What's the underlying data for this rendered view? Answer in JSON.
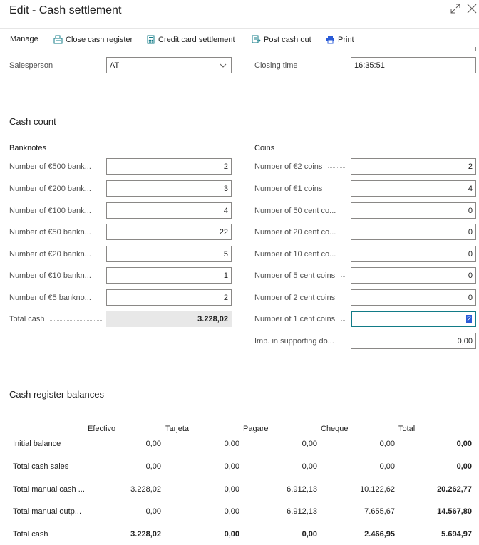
{
  "window": {
    "title": "Edit - Cash settlement"
  },
  "toolbar": {
    "manage": "Manage",
    "close_register": "Close cash register",
    "credit_card": "Credit card settlement",
    "post_cash_out": "Post cash out",
    "print": "Print"
  },
  "header": {
    "salesperson_label": "Salesperson",
    "salesperson_value": "AT",
    "closing_time_label": "Closing time",
    "closing_time_value": "16:35:51"
  },
  "cash_count": {
    "title": "Cash count",
    "banknotes_title": "Banknotes",
    "coins_title": "Coins",
    "banknotes": [
      {
        "label": "Number of €500 bank...",
        "value": "2"
      },
      {
        "label": "Number of €200 bank...",
        "value": "3"
      },
      {
        "label": "Number of €100 bank...",
        "value": "4"
      },
      {
        "label": "Number of €50 bankn...",
        "value": "22"
      },
      {
        "label": "Number of €20 bankn...",
        "value": "5"
      },
      {
        "label": "Number of €10 bankn...",
        "value": "1"
      },
      {
        "label": "Number of €5 bankno...",
        "value": "2"
      }
    ],
    "total_cash_label": "Total cash",
    "total_cash_value": "3.228,02",
    "coins": [
      {
        "label": "Number of €2 coins",
        "value": "2"
      },
      {
        "label": "Number of €1 coins",
        "value": "4"
      },
      {
        "label": "Number of 50 cent co...",
        "value": "0"
      },
      {
        "label": "Number of 20 cent co...",
        "value": "0"
      },
      {
        "label": "Number of 10 cent co...",
        "value": "0"
      },
      {
        "label": "Number of 5 cent coins",
        "value": "0"
      },
      {
        "label": "Number of 2 cent coins",
        "value": "0"
      },
      {
        "label": "Number of 1 cent coins",
        "value": "2"
      }
    ],
    "imp_label": "Imp. in supporting do...",
    "imp_value": "0,00"
  },
  "balances": {
    "title": "Cash register balances",
    "columns": [
      "Efectivo",
      "Tarjeta",
      "Pagare",
      "Cheque",
      "Total"
    ],
    "rows": [
      {
        "label": "Initial balance",
        "values": [
          "0,00",
          "0,00",
          "0,00",
          "0,00",
          "0,00"
        ]
      },
      {
        "label": "Total cash sales",
        "values": [
          "0,00",
          "0,00",
          "0,00",
          "0,00",
          "0,00"
        ]
      },
      {
        "label": "Total manual cash ...",
        "values": [
          "3.228,02",
          "0,00",
          "6.912,13",
          "10.122,62",
          "20.262,77"
        ]
      },
      {
        "label": "Total manual outp...",
        "values": [
          "0,00",
          "0,00",
          "6.912,13",
          "7.655,67",
          "14.567,80"
        ]
      },
      {
        "label": "Total cash",
        "values": [
          "3.228,02",
          "0,00",
          "0,00",
          "2.466,95",
          "5.694,97"
        ]
      }
    ]
  },
  "colors": {
    "accent": "#127b87",
    "selection": "#2a5bd7",
    "icon": "#127b87",
    "print_icon": "#2a5bd7"
  }
}
